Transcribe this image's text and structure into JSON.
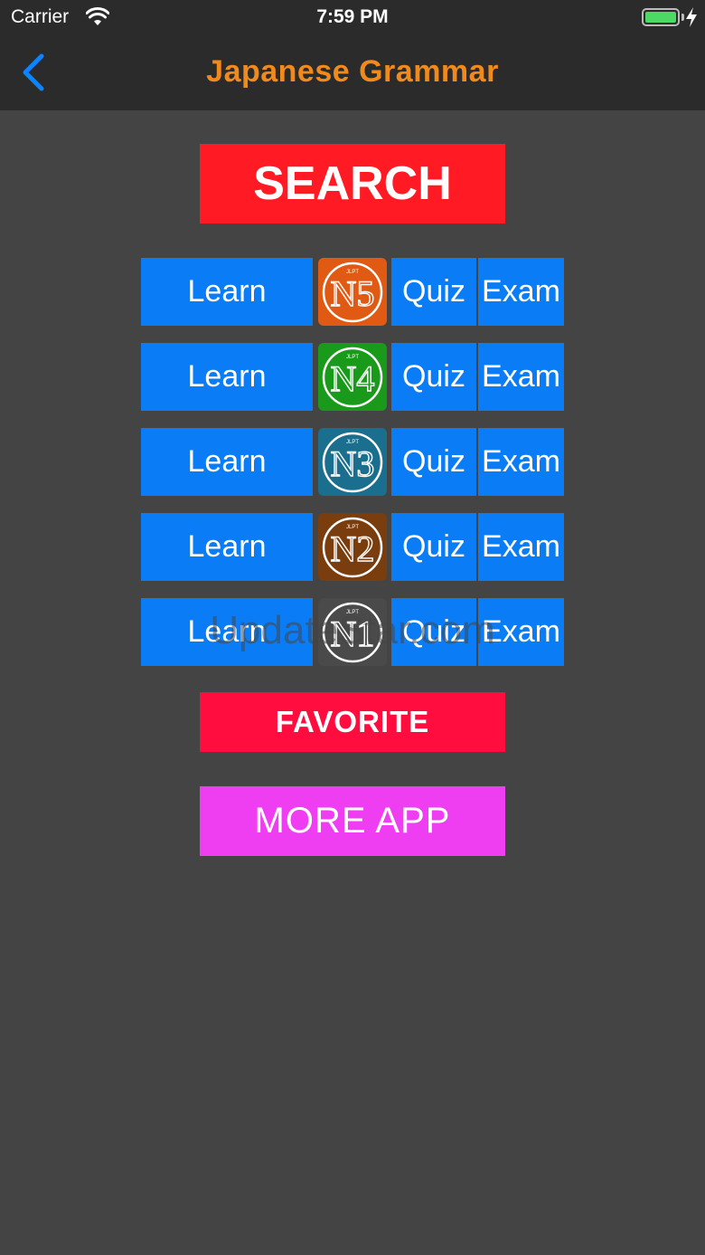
{
  "status_bar": {
    "carrier": "Carrier",
    "time": "7:59 PM"
  },
  "nav": {
    "title": "Japanese Grammar"
  },
  "search": {
    "label": "SEARCH"
  },
  "levels": [
    {
      "level": "N5",
      "jlpt": "JLPT",
      "learn": "Learn",
      "quiz": "Quiz",
      "exam": "Exam",
      "color": "#e05a14"
    },
    {
      "level": "N4",
      "jlpt": "JLPT",
      "learn": "Learn",
      "quiz": "Quiz",
      "exam": "Exam",
      "color": "#1a9a1a"
    },
    {
      "level": "N3",
      "jlpt": "JLPT",
      "learn": "Learn",
      "quiz": "Quiz",
      "exam": "Exam",
      "color": "#1a6e8e"
    },
    {
      "level": "N2",
      "jlpt": "JLPT",
      "learn": "Learn",
      "quiz": "Quiz",
      "exam": "Exam",
      "color": "#7a3d0e"
    },
    {
      "level": "N1",
      "jlpt": "JLPT",
      "learn": "Learn",
      "quiz": "Quiz",
      "exam": "Exam",
      "color": "#4a4a4a"
    }
  ],
  "favorite": {
    "label": "FAVORITE"
  },
  "more_app": {
    "label": "MORE APP"
  },
  "watermark": "UpdateStar.com",
  "colors": {
    "accent": "#f08a1c",
    "blue": "#0a7cf5",
    "red": "#ff1a24",
    "pink": "#ef3ef2"
  }
}
